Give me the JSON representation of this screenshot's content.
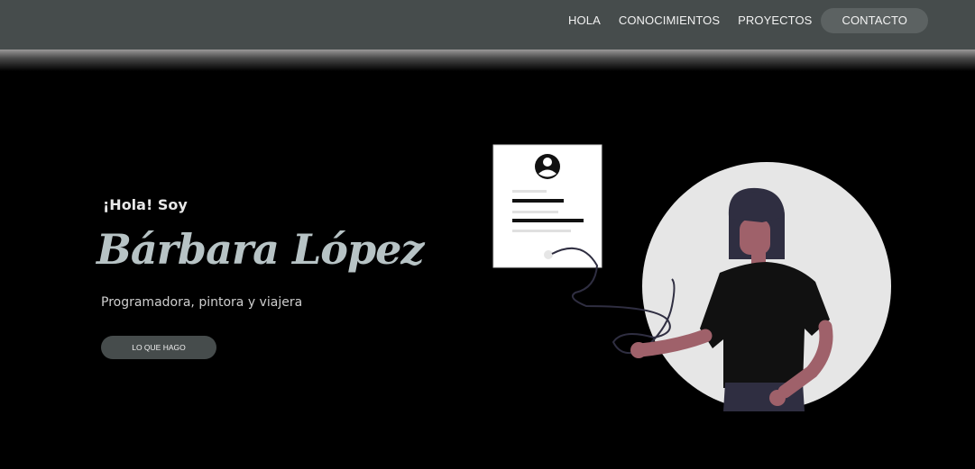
{
  "nav": {
    "items": [
      {
        "label": "HOLA"
      },
      {
        "label": "CONOCIMIENTOS"
      },
      {
        "label": "PROYECTOS"
      },
      {
        "label": "CONTACTO"
      }
    ]
  },
  "hero": {
    "greeting": "¡Hola! Soy",
    "name": "Bárbara López",
    "subtitle": "Programadora, pintora y viajera",
    "cta_label": "LO QUE HAGO"
  },
  "colors": {
    "navbar": "#464c4c",
    "active_nav": "#5c6262",
    "background": "#000000",
    "name": "#b7c3c5",
    "circle": "#e6e6e6",
    "skin": "#9f616a",
    "hair": "#2f2e41",
    "shirt": "#111111"
  },
  "icons": {
    "profile": "user-avatar-icon"
  }
}
